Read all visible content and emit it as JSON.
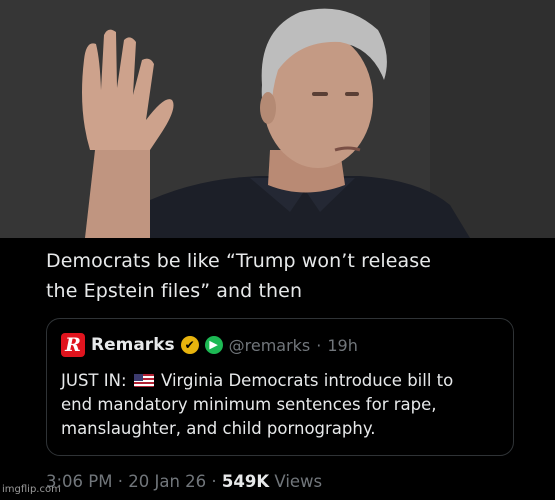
{
  "photo": {
    "description_icon": "person-photo",
    "bg_color": "#363636"
  },
  "post": {
    "text_line1": "Democrats be like “Trump won’t release",
    "text_line2": "the Epstein files” and then"
  },
  "quote": {
    "logo_letter": "R",
    "name": "Remarks",
    "handle": "@remarks",
    "separator": "·",
    "age": "19h",
    "body_prefix": "JUST IN:",
    "body_rest_line1": "Virginia Democrats introduce bill to",
    "body_line2": "end mandatory minimum sentences for rape,",
    "body_line3": "manslaughter, and child pornography.",
    "verified_icon": "✔",
    "affiliate_icon": "▶"
  },
  "meta": {
    "time": "3:06 PM",
    "sep1": "·",
    "date": "20 Jan 26",
    "sep2": "·",
    "views_count": "549K",
    "views_label": "Views"
  },
  "watermark": "imgflip.com",
  "colors": {
    "background": "#000000",
    "text": "#e7e9ea",
    "muted": "#71767b",
    "border": "#2f3336",
    "verified_gold": "#e8b40e",
    "brand_red": "#e0141e"
  }
}
